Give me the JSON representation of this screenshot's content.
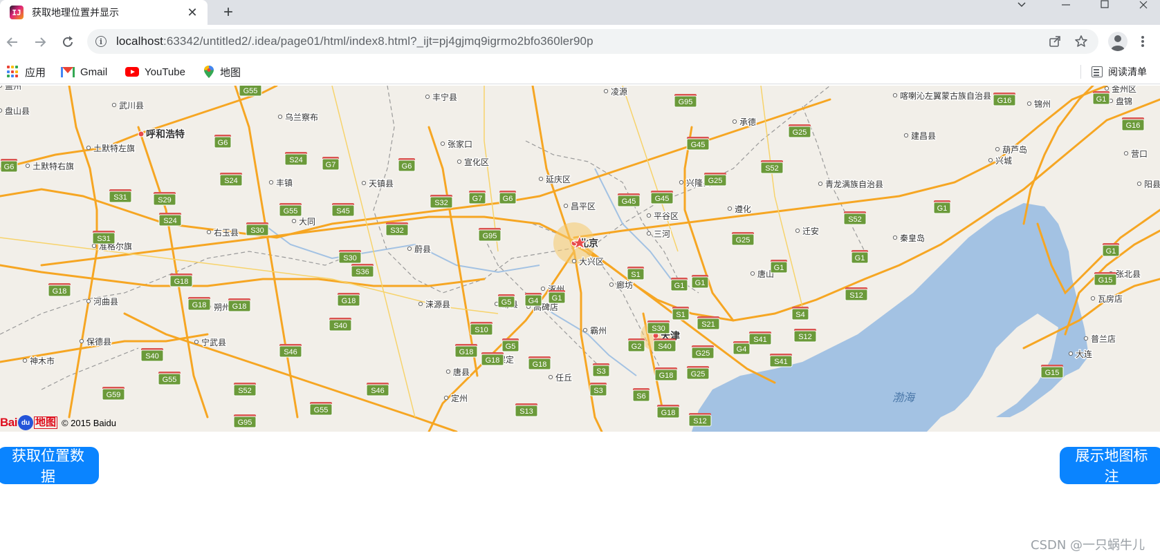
{
  "browser": {
    "tab_title": "获取地理位置并显示",
    "tab_favicon_letters": "IJ",
    "new_tab_symbol": "+",
    "close_symbol": "✕",
    "url_host": "localhost",
    "url_path": ":63342/untitled2/.idea/page01/html/index8.html?_ijt=pj4gjmq9igrmo2bfo360ler90p"
  },
  "bookmarks": [
    {
      "label": "应用",
      "icon": "apps-icon"
    },
    {
      "label": "Gmail",
      "icon": "gmail-icon"
    },
    {
      "label": "YouTube",
      "icon": "youtube-icon"
    },
    {
      "label": "地图",
      "icon": "maps-icon"
    }
  ],
  "reading_list": {
    "label": "阅读清单",
    "icon": "reading-list-icon"
  },
  "map": {
    "logo_text": "Bai",
    "logo_paw": "du",
    "logo_ditu": "地图",
    "copyright": "© 2015 Baidu",
    "sea_label": "渤海",
    "cities": [
      {
        "name": "北京",
        "major": true
      },
      {
        "name": "天津",
        "major": true
      },
      {
        "name": "呼和浩特",
        "major": true
      },
      {
        "name": "张家口"
      },
      {
        "name": "承德"
      },
      {
        "name": "大同"
      },
      {
        "name": "保定"
      },
      {
        "name": "唐山"
      },
      {
        "name": "秦皇岛"
      },
      {
        "name": "廊坊"
      },
      {
        "name": "朔州"
      },
      {
        "name": "乌兰察布"
      },
      {
        "name": "葫芦岛"
      },
      {
        "name": "锦州"
      },
      {
        "name": "盘锦"
      },
      {
        "name": "营口"
      },
      {
        "name": "大连"
      },
      {
        "name": "武川县"
      },
      {
        "name": "土默特左旗"
      },
      {
        "name": "土默特右旗"
      },
      {
        "name": "丰镇"
      },
      {
        "name": "天镇县"
      },
      {
        "name": "宣化区"
      },
      {
        "name": "延庆区"
      },
      {
        "name": "昌平区"
      },
      {
        "name": "平谷区"
      },
      {
        "name": "三河"
      },
      {
        "name": "大兴区"
      },
      {
        "name": "涿州"
      },
      {
        "name": "高碑店"
      },
      {
        "name": "霸州"
      },
      {
        "name": "任丘"
      },
      {
        "name": "易县"
      },
      {
        "name": "涞源县"
      },
      {
        "name": "蔚县"
      },
      {
        "name": "右玉县"
      },
      {
        "name": "准格尔旗"
      },
      {
        "name": "河曲县"
      },
      {
        "name": "保德县"
      },
      {
        "name": "宁武县"
      },
      {
        "name": "神木市"
      },
      {
        "name": "唐县"
      },
      {
        "name": "定州"
      },
      {
        "name": "兴隆县"
      },
      {
        "name": "遵化"
      },
      {
        "name": "迁安"
      },
      {
        "name": "青龙满族自治县"
      },
      {
        "name": "建昌县"
      },
      {
        "name": "兴城"
      },
      {
        "name": "喀喇沁左翼蒙古族自治县"
      },
      {
        "name": "凌源"
      },
      {
        "name": "丰宁县"
      },
      {
        "name": "张北县"
      },
      {
        "name": "瓦房店"
      },
      {
        "name": "普兰店"
      },
      {
        "name": "金州区"
      },
      {
        "name": "盘山县"
      },
      {
        "name": "阳县"
      },
      {
        "name": "盖州"
      }
    ],
    "road_shields": [
      "G55",
      "G6",
      "G7",
      "G6",
      "S24",
      "S24",
      "S29",
      "S31",
      "S31",
      "S24",
      "G55",
      "S30",
      "S30",
      "S45",
      "S32",
      "S32",
      "G7",
      "G6",
      "G95",
      "G45",
      "G45",
      "G25",
      "G25",
      "G95",
      "S52",
      "S52",
      "G45",
      "G1",
      "G16",
      "G1",
      "G16",
      "G1",
      "G18",
      "G18",
      "G18",
      "G18",
      "S36",
      "G18",
      "S40",
      "S40",
      "S46",
      "G59",
      "G55",
      "S52",
      "S46",
      "G55",
      "G95",
      "G5",
      "G4",
      "G1",
      "S1",
      "G1",
      "G1",
      "G25",
      "G1",
      "G1",
      "S12",
      "G15",
      "S10",
      "G5",
      "G18",
      "G18",
      "G18",
      "G4",
      "S30",
      "S1",
      "S21",
      "S4",
      "S12",
      "S41",
      "S41",
      "G2",
      "S40",
      "G25",
      "G18",
      "G25",
      "S3",
      "S3",
      "S6",
      "G18",
      "S12",
      "S13",
      "G15",
      "G6"
    ]
  },
  "buttons": {
    "get_location": "获取位置数据",
    "show_marker": "展示地图标注"
  },
  "watermark": "CSDN @一只蜗牛儿",
  "colors": {
    "accent_button": "#0a84ff",
    "map_land": "#f2efe9",
    "map_sea": "#a3c2e3",
    "road_highway": "#f6a623",
    "shield_green": "#6b9a3a"
  }
}
